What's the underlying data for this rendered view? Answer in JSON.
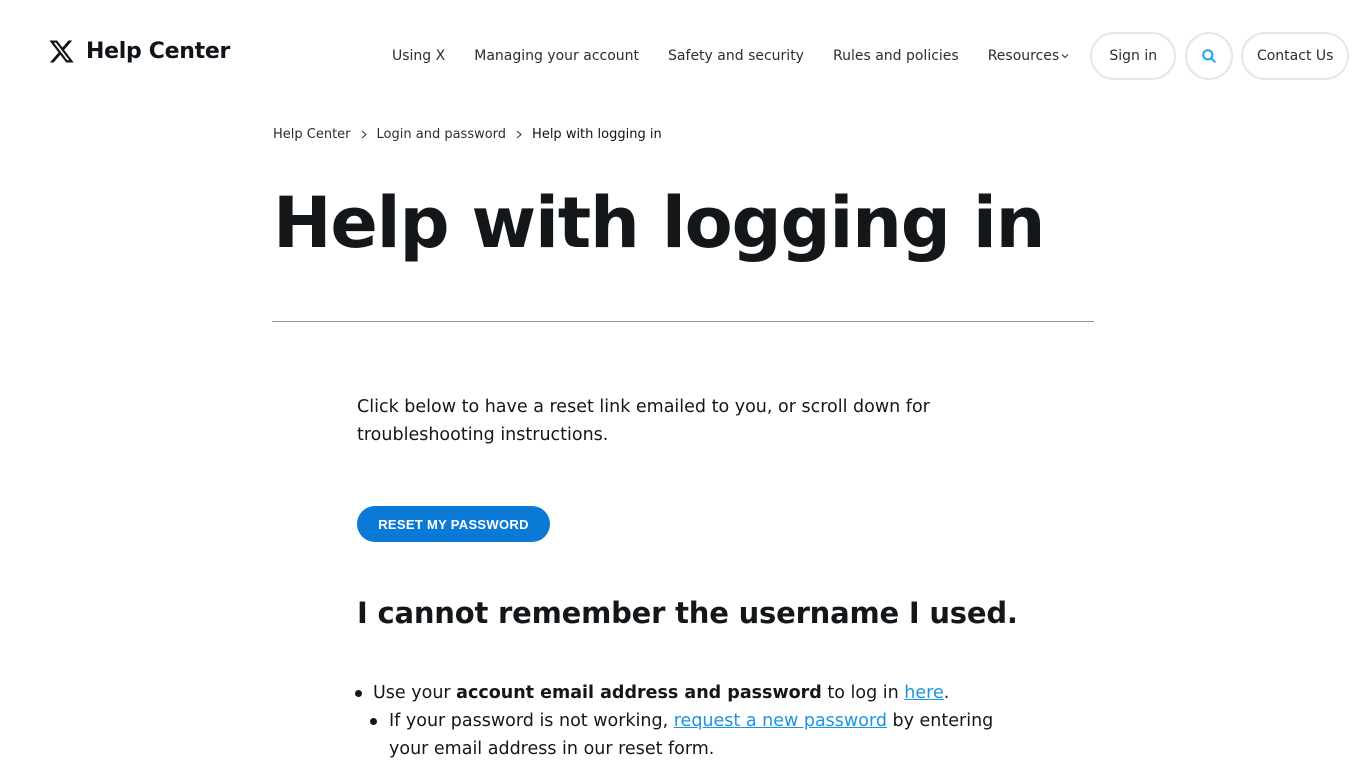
{
  "header": {
    "logo_text": "Help Center",
    "nav": [
      {
        "label": "Using X"
      },
      {
        "label": "Managing your account"
      },
      {
        "label": "Safety and security"
      },
      {
        "label": "Rules and policies"
      },
      {
        "label": "Resources"
      }
    ],
    "sign_in": "Sign in",
    "contact": "Contact Us",
    "icons": {
      "logo": "x-logo-icon",
      "search": "search-icon",
      "dropdown": "chevron-down-icon"
    }
  },
  "breadcrumb": [
    {
      "label": "Help Center"
    },
    {
      "label": "Login and password"
    },
    {
      "label": "Help with logging in"
    }
  ],
  "page_title": "Help with logging in",
  "intro": "Click below to have a reset link emailed to you, or scroll down for troubleshooting instructions.",
  "reset_button": "RESET MY PASSWORD",
  "section_heading": "I cannot remember the username I used.",
  "list": {
    "item1": {
      "pre": "Use your ",
      "bold": "account email address and password",
      "mid": " to log in ",
      "link": "here",
      "post": "."
    },
    "item2": {
      "pre": "If your password is not working, ",
      "link": "request a new password",
      "post": " by entering your email address in our reset form."
    }
  },
  "colors": {
    "accent_button": "#0b7ad6",
    "link": "#1b95e0",
    "search_icon": "#1da1f2",
    "text": "#14171a"
  }
}
